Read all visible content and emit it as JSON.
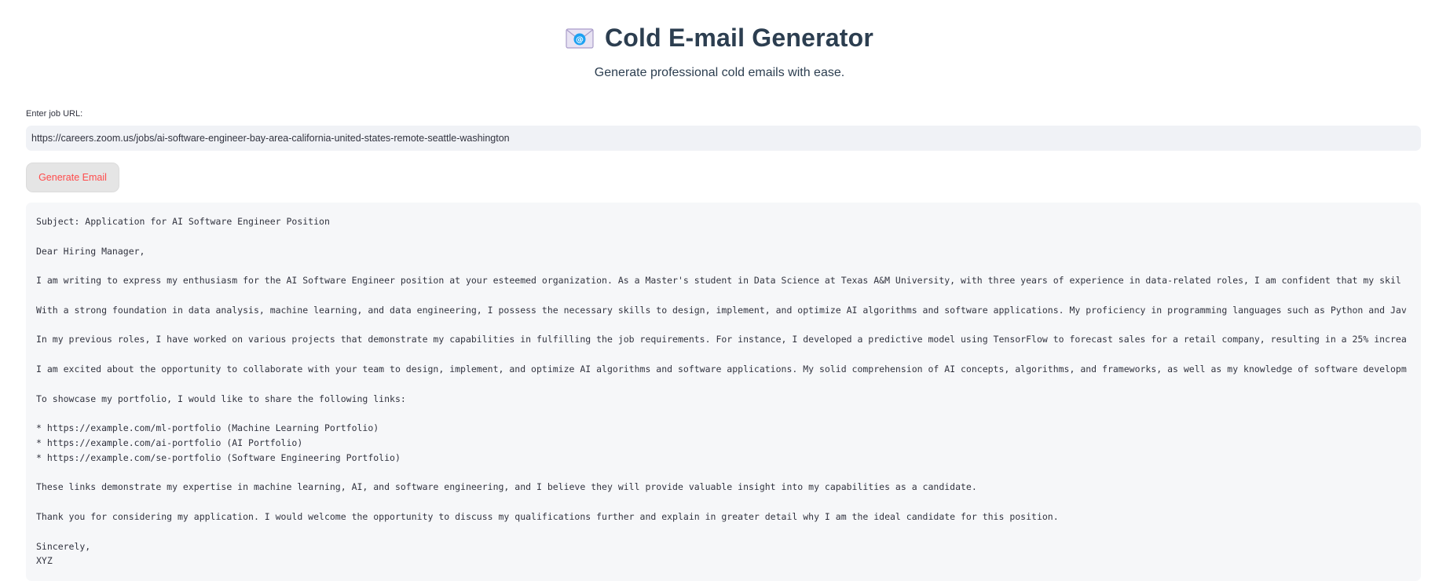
{
  "header": {
    "icon": "envelope-icon",
    "title": "Cold E-mail Generator",
    "subtitle": "Generate professional cold emails with ease."
  },
  "url_field": {
    "label": "Enter job URL:",
    "value": "https://careers.zoom.us/jobs/ai-software-engineer-bay-area-california-united-states-remote-seattle-washington"
  },
  "generate_button": {
    "label": "Generate Email"
  },
  "email_output": {
    "lines": [
      "Subject: Application for AI Software Engineer Position",
      "",
      "Dear Hiring Manager,",
      "",
      "I am writing to express my enthusiasm for the AI Software Engineer position at your esteemed organization. As a Master's student in Data Science at Texas A&M University, with three years of experience in data-related roles, I am confident that my skil",
      "",
      "With a strong foundation in data analysis, machine learning, and data engineering, I possess the necessary skills to design, implement, and optimize AI algorithms and software applications. My proficiency in programming languages such as Python and Jav",
      "",
      "In my previous roles, I have worked on various projects that demonstrate my capabilities in fulfilling the job requirements. For instance, I developed a predictive model using TensorFlow to forecast sales for a retail company, resulting in a 25% increa",
      "",
      "I am excited about the opportunity to collaborate with your team to design, implement, and optimize AI algorithms and software applications. My solid comprehension of AI concepts, algorithms, and frameworks, as well as my knowledge of software developm",
      "",
      "To showcase my portfolio, I would like to share the following links:",
      "",
      "* https://example.com/ml-portfolio (Machine Learning Portfolio)",
      "* https://example.com/ai-portfolio (AI Portfolio)",
      "* https://example.com/se-portfolio (Software Engineering Portfolio)",
      "",
      "These links demonstrate my expertise in machine learning, AI, and software engineering, and I believe they will provide valuable insight into my capabilities as a candidate.",
      "",
      "Thank you for considering my application. I would welcome the opportunity to discuss my qualifications further and explain in greater detail why I am the ideal candidate for this position.",
      "",
      "Sincerely,",
      "XYZ"
    ]
  },
  "colors": {
    "title": "#2c3e50",
    "button_text": "#ff4b4b",
    "input_bg": "#f0f2f6",
    "output_bg": "#f6f7f9"
  }
}
